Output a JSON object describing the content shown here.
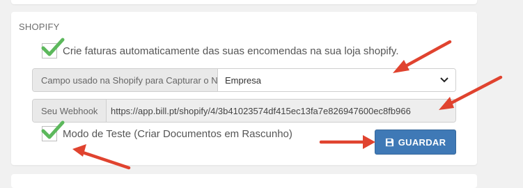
{
  "section": {
    "title": "SHOPIFY"
  },
  "auto_invoice": {
    "checked": true,
    "label": "Crie faturas automaticamente das suas encomendas na sua loja shopify."
  },
  "nif_field": {
    "label": "Campo usado na Shopify para Capturar o NIF",
    "selected": "Empresa"
  },
  "webhook": {
    "label": "Seu Webhook",
    "value": "https://app.bill.pt/shopify/4/3b41023574df415ec13fa7e826947600ec8fb966"
  },
  "test_mode": {
    "checked": true,
    "label": "Modo de Teste (Criar Documentos em Rascunho)"
  },
  "save_button": {
    "label": "GUARDAR",
    "icon": "floppy-disk-icon"
  },
  "colors": {
    "check": "#5cb85c",
    "button": "#3f79b6",
    "annotation_arrow": "#e0432f"
  }
}
